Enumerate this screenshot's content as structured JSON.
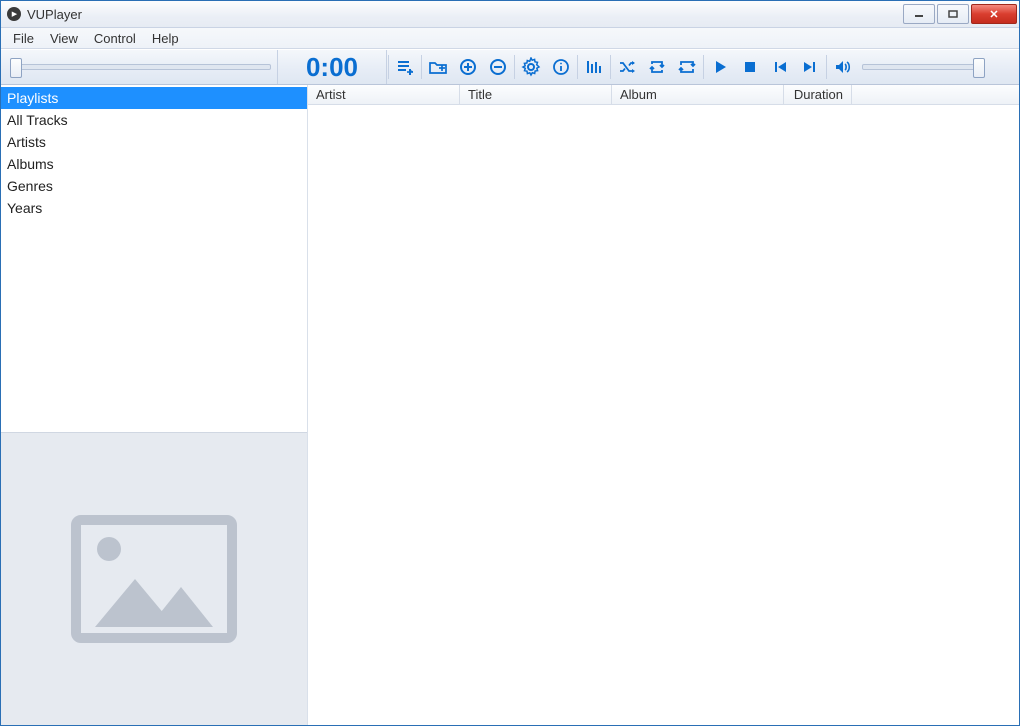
{
  "window": {
    "title": "VUPlayer"
  },
  "menu": {
    "file": "File",
    "view": "View",
    "control": "Control",
    "help": "Help"
  },
  "toolbar": {
    "time": "0:00"
  },
  "sidebar": {
    "items": [
      {
        "label": "Playlists",
        "selected": true
      },
      {
        "label": "All Tracks",
        "selected": false
      },
      {
        "label": "Artists",
        "selected": false
      },
      {
        "label": "Albums",
        "selected": false
      },
      {
        "label": "Genres",
        "selected": false
      },
      {
        "label": "Years",
        "selected": false
      }
    ]
  },
  "columns": {
    "artist": "Artist",
    "title": "Title",
    "album": "Album",
    "duration": "Duration"
  },
  "tracks": []
}
